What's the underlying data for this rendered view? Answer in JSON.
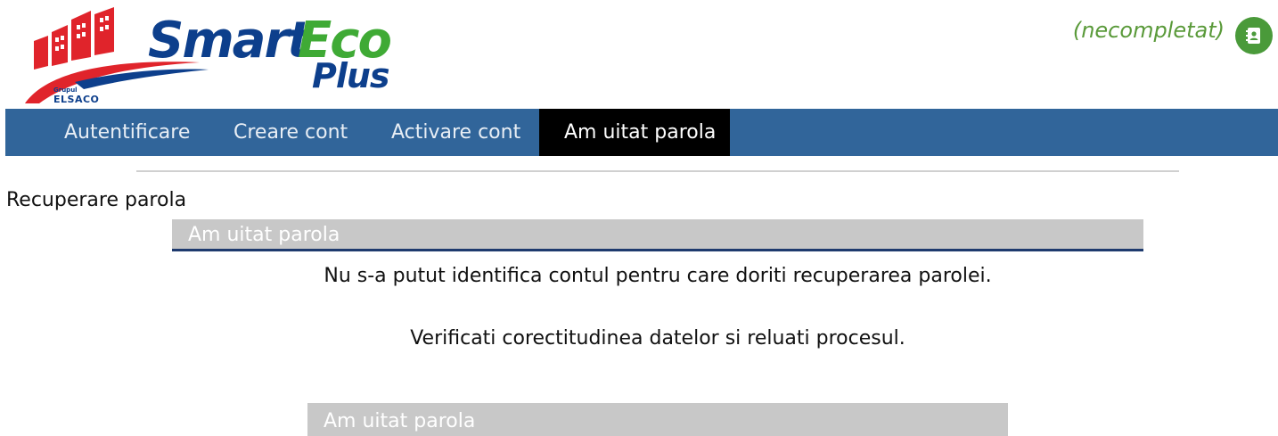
{
  "brand": {
    "smart": "Smart",
    "eco": "Eco",
    "plus": "Plus",
    "grupul": "Grupul",
    "elsaco": "ELSACO",
    "colors": {
      "blue": "#0d3f8c",
      "green": "#3faa35",
      "red": "#e0242b"
    }
  },
  "header": {
    "user_status": "(necompletat)",
    "contact_icon": "contact-book-icon"
  },
  "nav": {
    "items": [
      {
        "label": "Autentificare",
        "active": false
      },
      {
        "label": "Creare cont",
        "active": false
      },
      {
        "label": "Activare cont",
        "active": false
      },
      {
        "label": "Am uitat parola",
        "active": true
      }
    ],
    "bar_color": "#31659a",
    "active_color": "#000000"
  },
  "main": {
    "section_label": "Recuperare parola",
    "panel_title": "Am uitat parola",
    "message_line1": "Nu s-a putut identifica contul pentru care doriti recuperarea parolei.",
    "message_line2": "Verificati corectitudinea datelor si reluati procesul.",
    "panel2_title": "Am uitat parola"
  }
}
